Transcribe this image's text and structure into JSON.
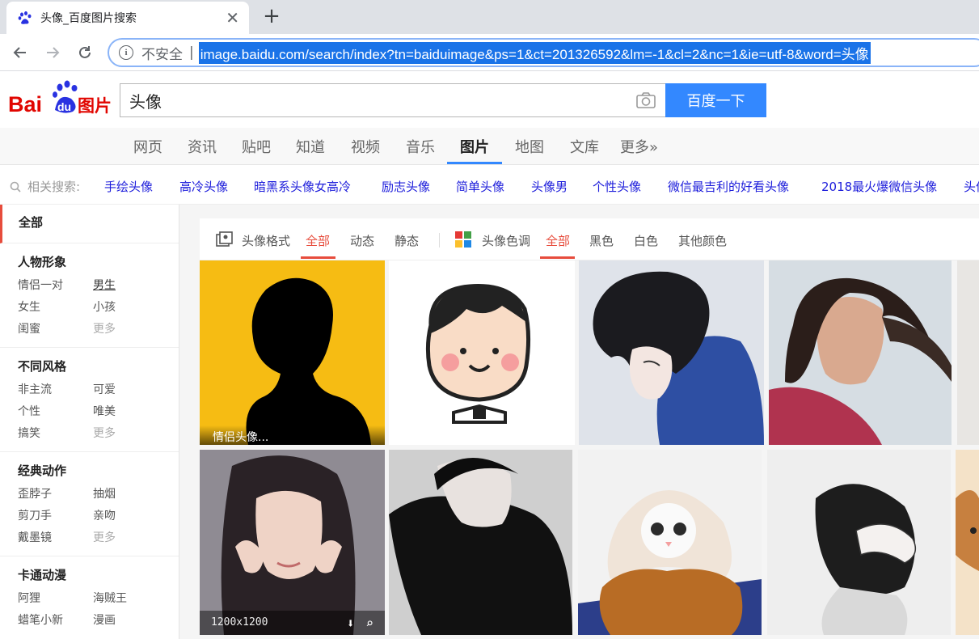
{
  "browser": {
    "tab_title": "头像_百度图片搜索",
    "tab_close": "✕",
    "new_tab": "+",
    "security_label": "不安全",
    "separator": "|",
    "url": "image.baidu.com/search/index?tn=baiduimage&ps=1&ct=201326592&lm=-1&cl=2&nc=1&ie=utf-8&word=头像"
  },
  "header": {
    "logo_text_left": "Bai",
    "logo_text_du": "du",
    "logo_text_right": "图片",
    "search_value": "头像",
    "search_button": "百度一下"
  },
  "nav": {
    "tabs": [
      "网页",
      "资讯",
      "贴吧",
      "知道",
      "视频",
      "音乐",
      "图片",
      "地图",
      "文库",
      "更多»"
    ],
    "active": "图片"
  },
  "related": {
    "label": "相关搜索:",
    "links": [
      "手绘头像",
      "高冷头像",
      "暗黑系头像女高冷",
      "励志头像",
      "简单头像",
      "头像男",
      "个性头像",
      "微信最吉利的好看头像",
      "2018最火爆微信头像",
      "头像"
    ]
  },
  "sidebar": {
    "all": "全部",
    "groups": [
      {
        "title": "人物形象",
        "rows": [
          [
            "情侣一对",
            "男生"
          ],
          [
            "女生",
            "小孩"
          ],
          [
            "闺蜜",
            "更多"
          ]
        ]
      },
      {
        "title": "不同风格",
        "rows": [
          [
            "非主流",
            "可爱"
          ],
          [
            "个性",
            "唯美"
          ],
          [
            "搞笑",
            "更多"
          ]
        ]
      },
      {
        "title": "经典动作",
        "rows": [
          [
            "歪脖子",
            "抽烟"
          ],
          [
            "剪刀手",
            "亲吻"
          ],
          [
            "戴墨镜",
            "更多"
          ]
        ]
      },
      {
        "title": "卡通动漫",
        "rows": [
          [
            "阿狸",
            "海贼王"
          ],
          [
            "蜡笔小新",
            "漫画"
          ]
        ]
      }
    ]
  },
  "filters": {
    "format_label": "头像格式",
    "format_options": [
      "全部",
      "动态",
      "静态"
    ],
    "color_label": "头像色调",
    "color_options": [
      "全部",
      "黑色",
      "白色",
      "其他颜色"
    ]
  },
  "results": {
    "caption_1": "情侣头像...",
    "size_5": "1200x1200"
  },
  "colors": {
    "baidu_blue": "#3388ff",
    "baidu_red": "#e10601",
    "active_red": "#e74c3c",
    "link_blue": "#1d1ddb"
  }
}
